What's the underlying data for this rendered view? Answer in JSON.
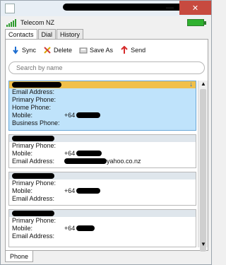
{
  "window": {
    "title": ""
  },
  "header": {
    "carrier": "Telecom NZ"
  },
  "tabs": [
    {
      "label": "Contacts",
      "active": true
    },
    {
      "label": "Dial",
      "active": false
    },
    {
      "label": "History",
      "active": false
    }
  ],
  "toolbar": {
    "sync_label": "Sync",
    "delete_label": "Delete",
    "save_as_label": "Save As",
    "send_label": "Send"
  },
  "search": {
    "placeholder": "Search by name"
  },
  "contacts": [
    {
      "selected": true,
      "rows": [
        {
          "label": "Email Address:",
          "value": ""
        },
        {
          "label": "Primary Phone:",
          "value": ""
        },
        {
          "label": "Home Phone:",
          "value": ""
        },
        {
          "label": "Mobile:",
          "value": "+64"
        },
        {
          "label": "Business Phone:",
          "value": ""
        }
      ]
    },
    {
      "selected": false,
      "rows": [
        {
          "label": "Primary Phone:",
          "value": ""
        },
        {
          "label": "Mobile:",
          "value": "+64"
        },
        {
          "label": "Email Address:",
          "value": "yahoo.co.nz"
        }
      ]
    },
    {
      "selected": false,
      "rows": [
        {
          "label": "Primary Phone:",
          "value": ""
        },
        {
          "label": "Mobile:",
          "value": "+64"
        },
        {
          "label": "Email Address:",
          "value": ""
        }
      ]
    },
    {
      "selected": false,
      "rows": [
        {
          "label": "Primary Phone:",
          "value": ""
        },
        {
          "label": "Mobile:",
          "value": "+64"
        },
        {
          "label": "Email Address:",
          "value": ""
        }
      ]
    }
  ],
  "bottom_tabs": [
    {
      "label": "Phone",
      "active": true
    }
  ],
  "colors": {
    "selected_header": "#f1c04a",
    "selected_body": "#bfe3fb",
    "close_button": "#c74a3f",
    "battery": "#2fb12f",
    "signal": "#2e9b2e"
  },
  "icons": {
    "sync": "sync-icon",
    "delete": "delete-icon",
    "save_as": "save-icon",
    "send": "send-icon"
  }
}
